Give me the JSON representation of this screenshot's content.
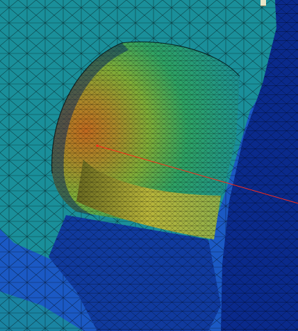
{
  "viewport": {
    "view_type": "FEA mesh contour plot",
    "corner_label_visible": true,
    "corner_label": ""
  },
  "colors": {
    "field_low": "#0a2a8c",
    "field_lowmid": "#1b59c4",
    "field_mid": "#1a8f9a",
    "field_midhigh": "#2ea364",
    "field_high": "#9fbe2a",
    "field_peak": "#c26a1f",
    "mesh_line": "#000000",
    "probe_line": "#ff2a1a"
  },
  "probe": {
    "visible": true
  }
}
